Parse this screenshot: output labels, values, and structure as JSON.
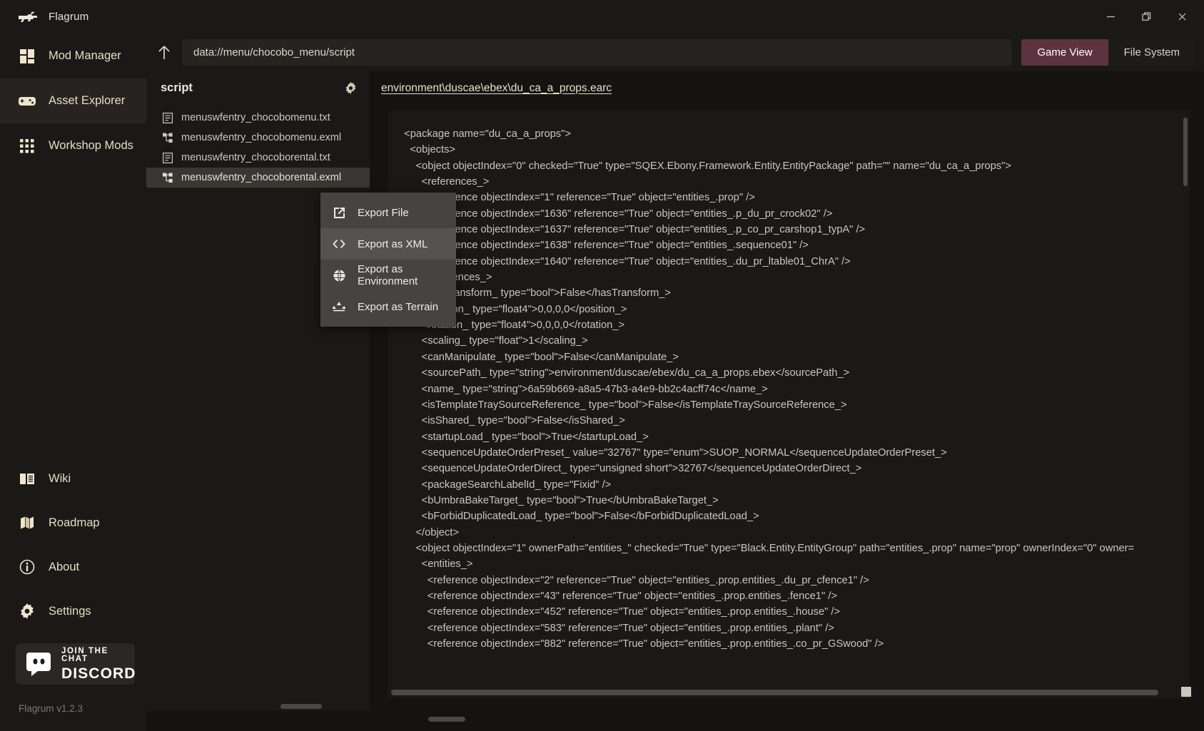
{
  "window": {
    "title": "Flagrum",
    "logo_icon": "gun-icon",
    "minimize_icon": "minimize-icon",
    "maximize_icon": "maximize-icon",
    "close_icon": "close-icon"
  },
  "sidebar": {
    "items": [
      {
        "label": "Mod Manager",
        "icon": "grid-blocks-icon",
        "active": false
      },
      {
        "label": "Asset Explorer",
        "icon": "gamepad-icon",
        "active": true
      },
      {
        "label": "Workshop Mods",
        "icon": "dots-grid-icon",
        "active": false
      }
    ],
    "lower_items": [
      {
        "label": "Wiki",
        "icon": "book-icon"
      },
      {
        "label": "Roadmap",
        "icon": "map-icon"
      },
      {
        "label": "About",
        "icon": "info-circle-icon"
      },
      {
        "label": "Settings",
        "icon": "gear-icon"
      }
    ],
    "discord": {
      "top_text": "JOIN THE CHAT",
      "bottom_text": "DISCORD",
      "icon": "discord-icon"
    },
    "version": "Flagrum v1.2.3"
  },
  "toolbar": {
    "up_icon": "arrow-up-icon",
    "address_value": "data://menu/chocobo_menu/script",
    "view_toggle": [
      {
        "label": "Game View",
        "selected": true
      },
      {
        "label": "File System",
        "selected": false
      }
    ],
    "accent_color": "#5e3341"
  },
  "file_pane": {
    "title": "script",
    "gear_icon": "gear-icon",
    "files": [
      {
        "name": "menuswfentry_chocobomenu.txt",
        "icon": "text-file-icon",
        "selected": false
      },
      {
        "name": "menuswfentry_chocobomenu.exml",
        "icon": "node-tree-icon",
        "selected": false
      },
      {
        "name": "menuswfentry_chocoborental.txt",
        "icon": "text-file-icon",
        "selected": false
      },
      {
        "name": "menuswfentry_chocoborental.exml",
        "icon": "node-tree-icon",
        "selected": true
      }
    ]
  },
  "viewer": {
    "path_link": "environment\\duscae\\ebex\\du_ca_a_props.earc",
    "lines": [
      "  <package name=\"du_ca_a_props\">",
      "    <objects>",
      "      <object objectIndex=\"0\" checked=\"True\" type=\"SQEX.Ebony.Framework.Entity.EntityPackage\" path=\"\" name=\"du_ca_a_props\">",
      "        <references_>",
      "          <reference objectIndex=\"1\" reference=\"True\" object=\"entities_.prop\" />",
      "          <reference objectIndex=\"1636\" reference=\"True\" object=\"entities_.p_du_pr_crock02\" />",
      "          <reference objectIndex=\"1637\" reference=\"True\" object=\"entities_.p_co_pr_carshop1_typA\" />",
      "          <reference objectIndex=\"1638\" reference=\"True\" object=\"entities_.sequence01\" />",
      "          <reference objectIndex=\"1640\" reference=\"True\" object=\"entities_.du_pr_ltable01_ChrA\" />",
      "        </references_>",
      "        <hasTransform_ type=\"bool\">False</hasTransform_>",
      "        <position_ type=\"float4\">0,0,0,0</position_>",
      "        <rotation_ type=\"float4\">0,0,0,0</rotation_>",
      "        <scaling_ type=\"float\">1</scaling_>",
      "        <canManipulate_ type=\"bool\">False</canManipulate_>",
      "        <sourcePath_ type=\"string\">environment/duscae/ebex/du_ca_a_props.ebex</sourcePath_>",
      "        <name_ type=\"string\">6a59b669-a8a5-47b3-a4e9-bb2c4acff74c</name_>",
      "        <isTemplateTraySourceReference_ type=\"bool\">False</isTemplateTraySourceReference_>",
      "        <isShared_ type=\"bool\">False</isShared_>",
      "        <startupLoad_ type=\"bool\">True</startupLoad_>",
      "        <sequenceUpdateOrderPreset_ value=\"32767\" type=\"enum\">SUOP_NORMAL</sequenceUpdateOrderPreset_>",
      "        <sequenceUpdateOrderDirect_ type=\"unsigned short\">32767</sequenceUpdateOrderDirect_>",
      "        <packageSearchLabelId_ type=\"Fixid\" />",
      "        <bUmbraBakeTarget_ type=\"bool\">True</bUmbraBakeTarget_>",
      "        <bForbidDuplicatedLoad_ type=\"bool\">False</bForbidDuplicatedLoad_>",
      "      </object>",
      "      <object objectIndex=\"1\" ownerPath=\"entities_\" checked=\"True\" type=\"Black.Entity.EntityGroup\" path=\"entities_.prop\" name=\"prop\" ownerIndex=\"0\" owner=",
      "        <entities_>",
      "          <reference objectIndex=\"2\" reference=\"True\" object=\"entities_.prop.entities_.du_pr_cfence1\" />",
      "          <reference objectIndex=\"43\" reference=\"True\" object=\"entities_.prop.entities_.fence1\" />",
      "          <reference objectIndex=\"452\" reference=\"True\" object=\"entities_.prop.entities_.house\" />",
      "          <reference objectIndex=\"583\" reference=\"True\" object=\"entities_.prop.entities_.plant\" />",
      "          <reference objectIndex=\"882\" reference=\"True\" object=\"entities_.prop.entities_.co_pr_GSwood\" />"
    ]
  },
  "context_menu": {
    "items": [
      {
        "label": "Export File",
        "icon": "export-box-icon",
        "highlighted": false
      },
      {
        "label": "Export as XML",
        "icon": "code-brackets-icon",
        "highlighted": true
      },
      {
        "label": "Export as Environment",
        "icon": "globe-icon",
        "highlighted": false
      },
      {
        "label": "Export as Terrain",
        "icon": "terrain-icon",
        "highlighted": false
      }
    ]
  }
}
